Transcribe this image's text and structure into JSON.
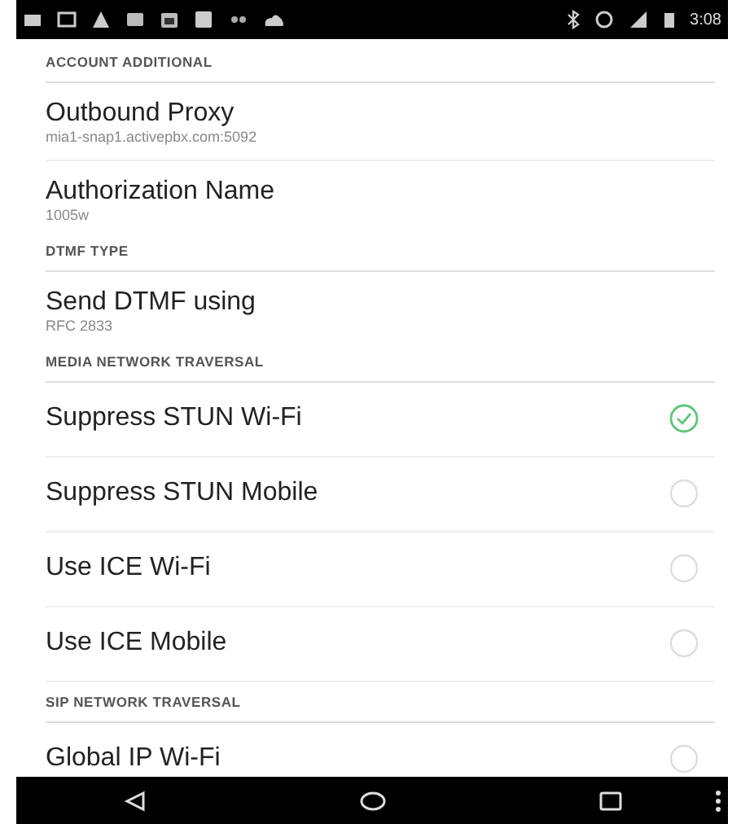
{
  "status_bar": {
    "time": "3:08"
  },
  "sections": [
    {
      "header": "ACCOUNT ADDITIONAL",
      "items": [
        {
          "kind": "summary",
          "title": "Outbound Proxy",
          "summary": "mia1-snap1.activepbx.com:5092"
        },
        {
          "kind": "summary",
          "title": "Authorization Name",
          "summary": "1005w"
        }
      ]
    },
    {
      "header": "DTMF TYPE",
      "items": [
        {
          "kind": "summary",
          "title": "Send DTMF using",
          "summary": "RFC 2833"
        }
      ]
    },
    {
      "header": "MEDIA NETWORK TRAVERSAL",
      "items": [
        {
          "kind": "checkbox",
          "title": "Suppress STUN Wi-Fi",
          "checked": true
        },
        {
          "kind": "checkbox",
          "title": "Suppress STUN Mobile",
          "checked": false
        },
        {
          "kind": "checkbox",
          "title": "Use ICE Wi-Fi",
          "checked": false
        },
        {
          "kind": "checkbox",
          "title": "Use ICE Mobile",
          "checked": false
        }
      ]
    },
    {
      "header": "SIP NETWORK TRAVERSAL",
      "items": [
        {
          "kind": "checkbox",
          "title": "Global IP Wi-Fi",
          "checked": false
        }
      ]
    }
  ]
}
